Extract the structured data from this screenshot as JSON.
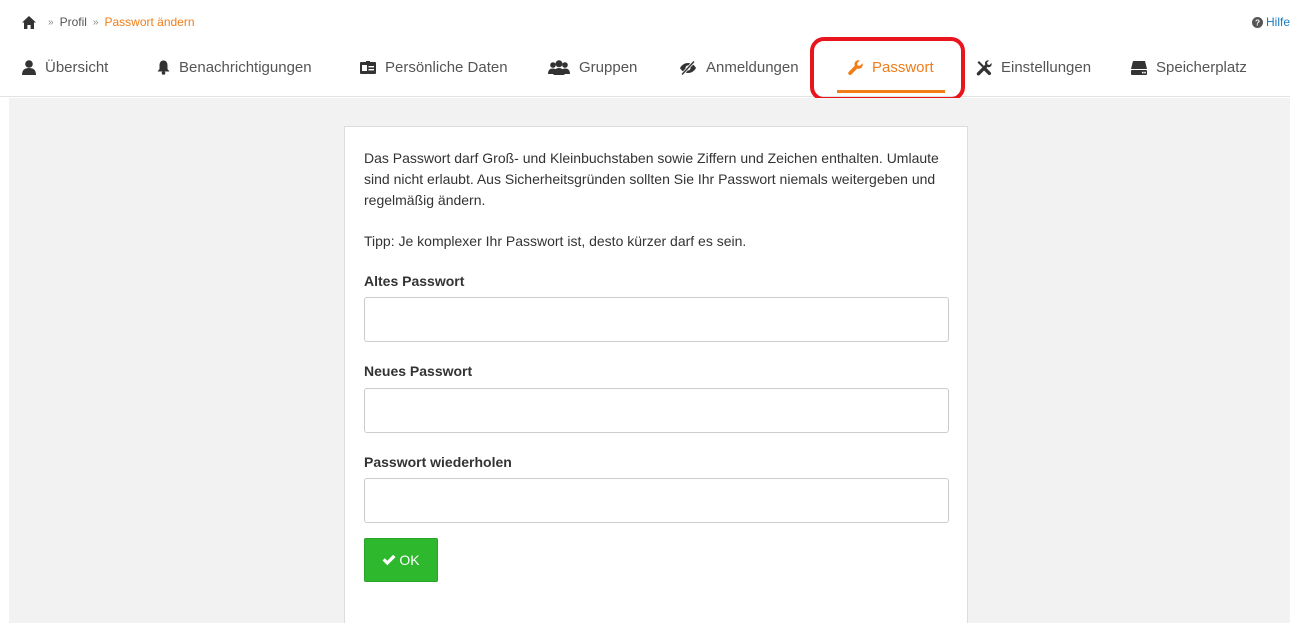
{
  "breadcrumb": {
    "home_icon": "home-icon",
    "separator": "»",
    "items": [
      "Profil",
      "Passwort ändern"
    ]
  },
  "help": {
    "label": "Hilfe",
    "icon": "question-circle-icon"
  },
  "tabs": [
    {
      "label": "Übersicht",
      "icon": "user-icon",
      "active": false
    },
    {
      "label": "Benachrichtigungen",
      "icon": "bell-icon",
      "active": false
    },
    {
      "label": "Persönliche Daten",
      "icon": "id-card-icon",
      "active": false
    },
    {
      "label": "Gruppen",
      "icon": "group-icon",
      "active": false
    },
    {
      "label": "Anmeldungen",
      "icon": "eye-slash-icon",
      "active": false
    },
    {
      "label": "Passwort",
      "icon": "wrench-icon",
      "active": true
    },
    {
      "label": "Einstellungen",
      "icon": "tools-icon",
      "active": false
    },
    {
      "label": "Speicherplatz",
      "icon": "hdd-icon",
      "active": false
    }
  ],
  "form": {
    "intro": "Das Passwort darf Groß- und Kleinbuchstaben sowie Ziffern und Zeichen enthalten. Umlaute sind nicht erlaubt. Aus Sicherheitsgründen sollten Sie Ihr Passwort niemals weitergeben und regelmäßig ändern.",
    "tip": "Tipp: Je komplexer Ihr Passwort ist, desto kürzer darf es sein.",
    "old_password": {
      "label": "Altes Passwort",
      "value": ""
    },
    "new_password": {
      "label": "Neues Passwort",
      "value": ""
    },
    "repeat_password": {
      "label": "Passwort wiederholen",
      "value": ""
    },
    "submit_label": "OK",
    "submit_icon": "checkmark-icon"
  },
  "colors": {
    "accent": "#f07d1a",
    "link": "#1a7bc1",
    "ok_button": "#2eb82e",
    "annotation": "#e8151d",
    "content_bg": "#f2f2f2"
  }
}
